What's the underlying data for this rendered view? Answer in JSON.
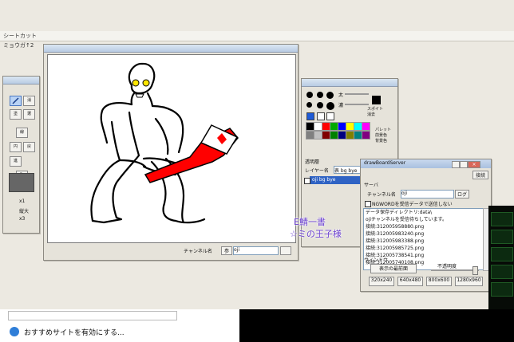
{
  "app": {
    "title": "シートカット",
    "menu": "ミョウガ↑2"
  },
  "tools": [
    {
      "label": "",
      "name": "pen-tool"
    },
    {
      "label": "消",
      "name": "eraser-tool"
    },
    {
      "label": "塗",
      "name": "fill-tool"
    },
    {
      "label": "選",
      "name": "select-tool"
    },
    {
      "label": "線",
      "name": "line-tool"
    },
    {
      "label": "円",
      "name": "circle-tool"
    },
    {
      "label": "戻",
      "name": "undo-tool"
    },
    {
      "label": "進",
      "name": "redo-tool"
    },
    {
      "label": "取",
      "name": "picker-tool"
    }
  ],
  "zoom": {
    "x1": "x1",
    "fit": "縦大",
    "x3": "x3"
  },
  "canvas_footer": {
    "label": "チャンネル名",
    "button": "参",
    "value": "oji"
  },
  "palette": {
    "labels": [
      "太",
      "濃",
      "スポイト",
      "消去",
      "パレット",
      "前景色",
      "背景色"
    ],
    "colors": [
      "#000000",
      "#ffffff",
      "#ff0000",
      "#00aa00",
      "#0000ff",
      "#ffff00",
      "#00ffff",
      "#ff00ff",
      "#808080",
      "#c0c0c0",
      "#800000",
      "#008000",
      "#000080",
      "#808000",
      "#008080",
      "#800080"
    ]
  },
  "layers": {
    "title": "透明層",
    "name_label": "レイヤー名",
    "mode": "表 bg bye",
    "row": "oji bg bye"
  },
  "server": {
    "title": "drawBoardServer",
    "btn_top": "接続",
    "section": "サーバ",
    "channel_label": "チャンネル名",
    "channel_value": "oji",
    "channel_btn": "ログ",
    "checkbox": "NGWORDを受信データで送信しない",
    "log": [
      "データ保存ディレクトリ:data\\",
      "ojiチャンネルを受信待ちしています。",
      "接続:312005958880.png",
      "接続:312005983240.png",
      "接続:312005983388.png",
      "接続:312005985725.png",
      "接続:312005738541.png",
      "接続:312005740108.png"
    ],
    "window_section": "ウィンドウ",
    "show_btn": "表示の最前面",
    "opacity_label": "不透明度",
    "sizes": [
      "320x240",
      "640x480",
      "800x600",
      "1280x960"
    ]
  },
  "overlay": {
    "line1": "E鯖一書",
    "line2": "☆ミの王子様"
  },
  "browser": {
    "suggest": "おすすめサイトを有効にする..."
  }
}
